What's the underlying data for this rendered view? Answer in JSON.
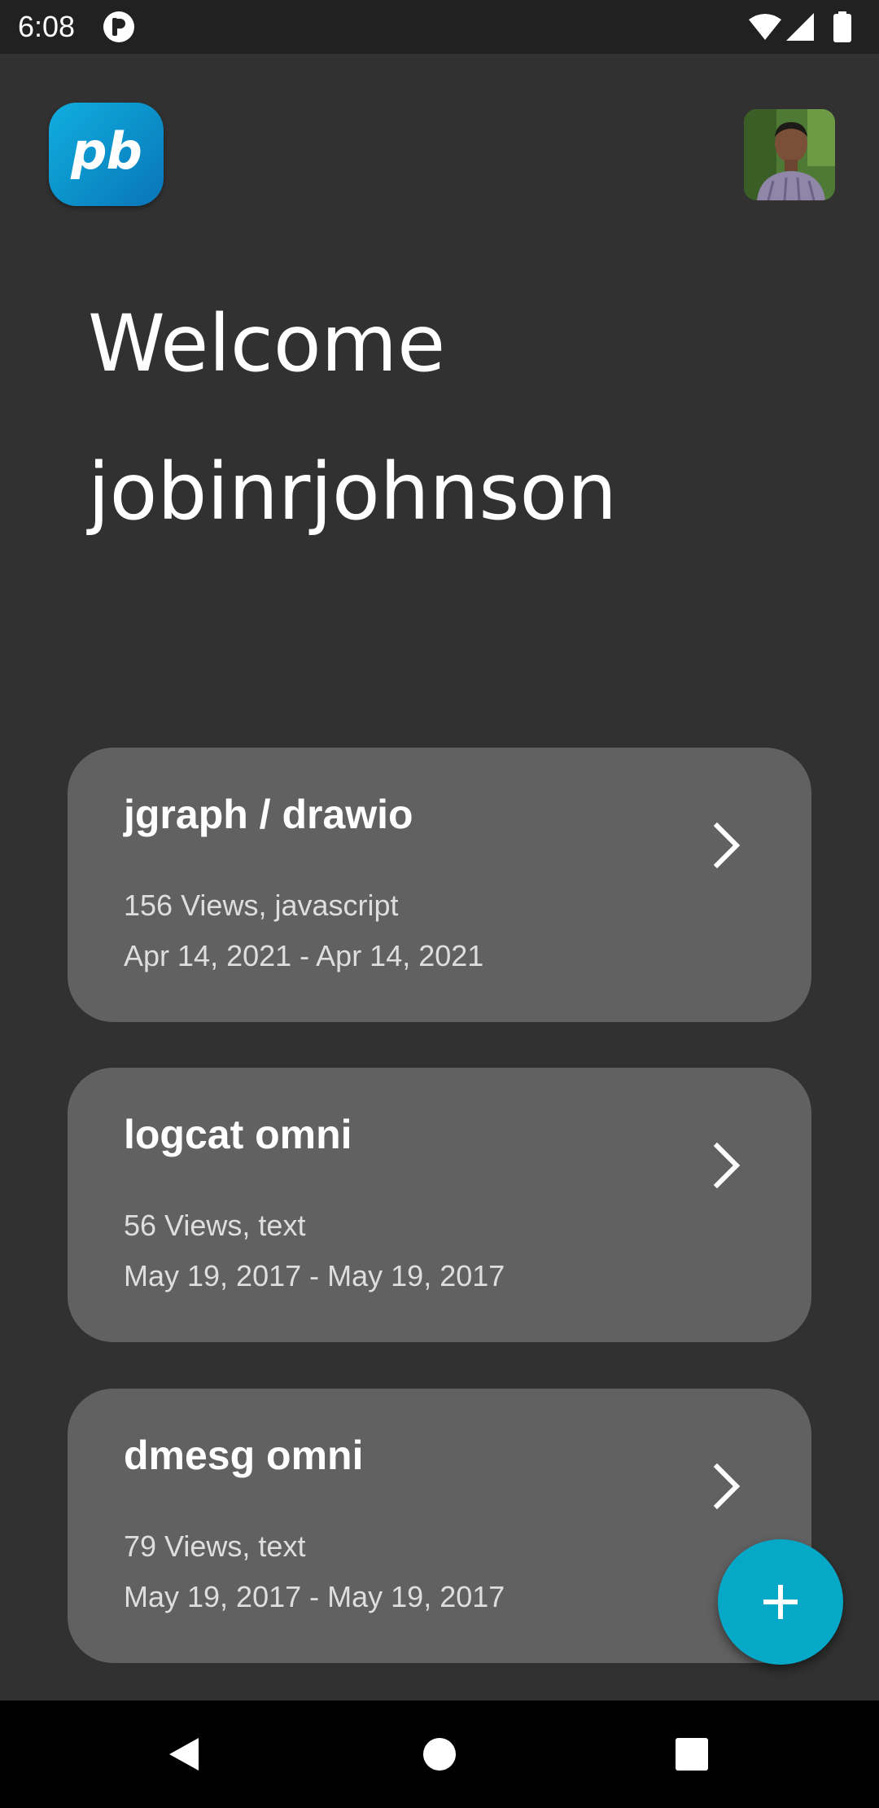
{
  "status_bar": {
    "time": "6:08",
    "notification_icon": "app-notification-icon",
    "wifi_icon": "wifi-icon",
    "signal_icon": "cell-signal-icon",
    "battery_icon": "battery-full-icon"
  },
  "header": {
    "logo_text": "pb",
    "logo_colors": [
      "#11aee0",
      "#0a74b9"
    ],
    "avatar_icon": "user-avatar"
  },
  "welcome": {
    "line1": "Welcome",
    "line2": "jobinrjohnson"
  },
  "cards": [
    {
      "title": "jgraph / drawio",
      "meta": "156 Views, javascript",
      "dates": "Apr 14, 2021 - Apr 14, 2021"
    },
    {
      "title": "logcat omni",
      "meta": "56 Views, text",
      "dates": "May 19, 2017 - May 19, 2017"
    },
    {
      "title": "dmesg omni",
      "meta": "79 Views, text",
      "dates": "May 19, 2017 - May 19, 2017"
    }
  ],
  "fab": {
    "icon": "plus-icon",
    "color": "#06a8c7"
  },
  "nav_bar": {
    "back_icon": "back-triangle-icon",
    "home_icon": "home-circle-icon",
    "recents_icon": "recents-square-icon"
  },
  "colors": {
    "background": "#313131",
    "card": "#616161",
    "status_bar": "#212121",
    "nav_bar": "#000000"
  }
}
